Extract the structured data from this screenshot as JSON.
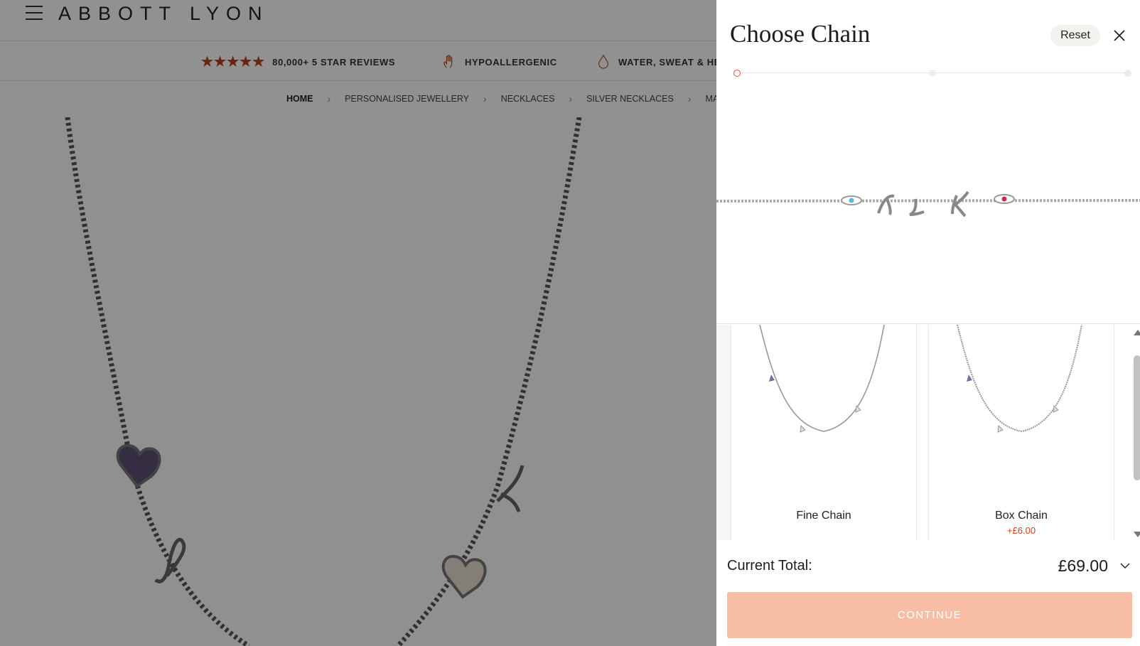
{
  "header": {
    "brand": "ABBOTT LYON"
  },
  "usp_bar": {
    "items": [
      {
        "icon": "star-rating-icon",
        "stars": 5,
        "label": "80,000+ 5 STAR REVIEWS"
      },
      {
        "icon": "hand-icon",
        "label": "HYPOALLERGENIC"
      },
      {
        "icon": "water-drop-icon",
        "label": "WATER, SWEAT & HE"
      }
    ]
  },
  "breadcrumb": {
    "items": [
      "HOME",
      "PERSONALISED JEWELLERY",
      "NECKLACES",
      "SILVER NECKLACES",
      "MADE MI"
    ]
  },
  "drawer": {
    "title": "Choose Chain",
    "reset_label": "Reset",
    "steps": {
      "count": 3,
      "active": 1
    },
    "options": [
      {
        "name": "Fine Chain",
        "price": ""
      },
      {
        "name": "Box Chain",
        "price": "+£6.00"
      }
    ],
    "total_label": "Current Total:",
    "total_value": "£69.00",
    "continue_label": "CONTINUE"
  },
  "colors": {
    "accent": "#c2461e",
    "continue_disabled": "#f8bda5",
    "stars": "#b5431e"
  }
}
